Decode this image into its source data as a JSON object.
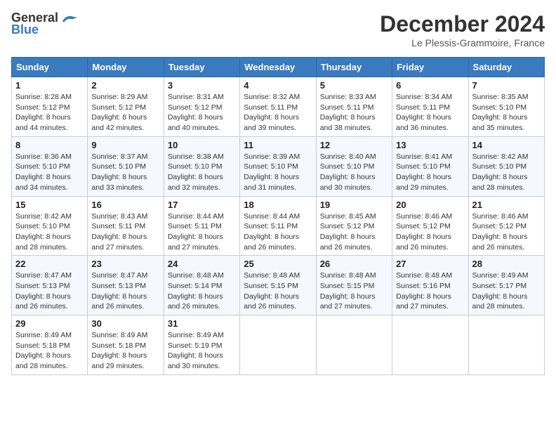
{
  "header": {
    "logo_line1": "General",
    "logo_line2": "Blue",
    "month": "December 2024",
    "location": "Le Plessis-Grammoire, France"
  },
  "days_of_week": [
    "Sunday",
    "Monday",
    "Tuesday",
    "Wednesday",
    "Thursday",
    "Friday",
    "Saturday"
  ],
  "weeks": [
    [
      {
        "day": "1",
        "sunrise": "Sunrise: 8:28 AM",
        "sunset": "Sunset: 5:12 PM",
        "daylight": "Daylight: 8 hours and 44 minutes."
      },
      {
        "day": "2",
        "sunrise": "Sunrise: 8:29 AM",
        "sunset": "Sunset: 5:12 PM",
        "daylight": "Daylight: 8 hours and 42 minutes."
      },
      {
        "day": "3",
        "sunrise": "Sunrise: 8:31 AM",
        "sunset": "Sunset: 5:12 PM",
        "daylight": "Daylight: 8 hours and 40 minutes."
      },
      {
        "day": "4",
        "sunrise": "Sunrise: 8:32 AM",
        "sunset": "Sunset: 5:11 PM",
        "daylight": "Daylight: 8 hours and 39 minutes."
      },
      {
        "day": "5",
        "sunrise": "Sunrise: 8:33 AM",
        "sunset": "Sunset: 5:11 PM",
        "daylight": "Daylight: 8 hours and 38 minutes."
      },
      {
        "day": "6",
        "sunrise": "Sunrise: 8:34 AM",
        "sunset": "Sunset: 5:11 PM",
        "daylight": "Daylight: 8 hours and 36 minutes."
      },
      {
        "day": "7",
        "sunrise": "Sunrise: 8:35 AM",
        "sunset": "Sunset: 5:10 PM",
        "daylight": "Daylight: 8 hours and 35 minutes."
      }
    ],
    [
      {
        "day": "8",
        "sunrise": "Sunrise: 8:36 AM",
        "sunset": "Sunset: 5:10 PM",
        "daylight": "Daylight: 8 hours and 34 minutes."
      },
      {
        "day": "9",
        "sunrise": "Sunrise: 8:37 AM",
        "sunset": "Sunset: 5:10 PM",
        "daylight": "Daylight: 8 hours and 33 minutes."
      },
      {
        "day": "10",
        "sunrise": "Sunrise: 8:38 AM",
        "sunset": "Sunset: 5:10 PM",
        "daylight": "Daylight: 8 hours and 32 minutes."
      },
      {
        "day": "11",
        "sunrise": "Sunrise: 8:39 AM",
        "sunset": "Sunset: 5:10 PM",
        "daylight": "Daylight: 8 hours and 31 minutes."
      },
      {
        "day": "12",
        "sunrise": "Sunrise: 8:40 AM",
        "sunset": "Sunset: 5:10 PM",
        "daylight": "Daylight: 8 hours and 30 minutes."
      },
      {
        "day": "13",
        "sunrise": "Sunrise: 8:41 AM",
        "sunset": "Sunset: 5:10 PM",
        "daylight": "Daylight: 8 hours and 29 minutes."
      },
      {
        "day": "14",
        "sunrise": "Sunrise: 8:42 AM",
        "sunset": "Sunset: 5:10 PM",
        "daylight": "Daylight: 8 hours and 28 minutes."
      }
    ],
    [
      {
        "day": "15",
        "sunrise": "Sunrise: 8:42 AM",
        "sunset": "Sunset: 5:10 PM",
        "daylight": "Daylight: 8 hours and 28 minutes."
      },
      {
        "day": "16",
        "sunrise": "Sunrise: 8:43 AM",
        "sunset": "Sunset: 5:11 PM",
        "daylight": "Daylight: 8 hours and 27 minutes."
      },
      {
        "day": "17",
        "sunrise": "Sunrise: 8:44 AM",
        "sunset": "Sunset: 5:11 PM",
        "daylight": "Daylight: 8 hours and 27 minutes."
      },
      {
        "day": "18",
        "sunrise": "Sunrise: 8:44 AM",
        "sunset": "Sunset: 5:11 PM",
        "daylight": "Daylight: 8 hours and 26 minutes."
      },
      {
        "day": "19",
        "sunrise": "Sunrise: 8:45 AM",
        "sunset": "Sunset: 5:12 PM",
        "daylight": "Daylight: 8 hours and 26 minutes."
      },
      {
        "day": "20",
        "sunrise": "Sunrise: 8:46 AM",
        "sunset": "Sunset: 5:12 PM",
        "daylight": "Daylight: 8 hours and 26 minutes."
      },
      {
        "day": "21",
        "sunrise": "Sunrise: 8:46 AM",
        "sunset": "Sunset: 5:12 PM",
        "daylight": "Daylight: 8 hours and 26 minutes."
      }
    ],
    [
      {
        "day": "22",
        "sunrise": "Sunrise: 8:47 AM",
        "sunset": "Sunset: 5:13 PM",
        "daylight": "Daylight: 8 hours and 26 minutes."
      },
      {
        "day": "23",
        "sunrise": "Sunrise: 8:47 AM",
        "sunset": "Sunset: 5:13 PM",
        "daylight": "Daylight: 8 hours and 26 minutes."
      },
      {
        "day": "24",
        "sunrise": "Sunrise: 8:48 AM",
        "sunset": "Sunset: 5:14 PM",
        "daylight": "Daylight: 8 hours and 26 minutes."
      },
      {
        "day": "25",
        "sunrise": "Sunrise: 8:48 AM",
        "sunset": "Sunset: 5:15 PM",
        "daylight": "Daylight: 8 hours and 26 minutes."
      },
      {
        "day": "26",
        "sunrise": "Sunrise: 8:48 AM",
        "sunset": "Sunset: 5:15 PM",
        "daylight": "Daylight: 8 hours and 27 minutes."
      },
      {
        "day": "27",
        "sunrise": "Sunrise: 8:48 AM",
        "sunset": "Sunset: 5:16 PM",
        "daylight": "Daylight: 8 hours and 27 minutes."
      },
      {
        "day": "28",
        "sunrise": "Sunrise: 8:49 AM",
        "sunset": "Sunset: 5:17 PM",
        "daylight": "Daylight: 8 hours and 28 minutes."
      }
    ],
    [
      {
        "day": "29",
        "sunrise": "Sunrise: 8:49 AM",
        "sunset": "Sunset: 5:18 PM",
        "daylight": "Daylight: 8 hours and 28 minutes."
      },
      {
        "day": "30",
        "sunrise": "Sunrise: 8:49 AM",
        "sunset": "Sunset: 5:18 PM",
        "daylight": "Daylight: 8 hours and 29 minutes."
      },
      {
        "day": "31",
        "sunrise": "Sunrise: 8:49 AM",
        "sunset": "Sunset: 5:19 PM",
        "daylight": "Daylight: 8 hours and 30 minutes."
      },
      null,
      null,
      null,
      null
    ]
  ]
}
